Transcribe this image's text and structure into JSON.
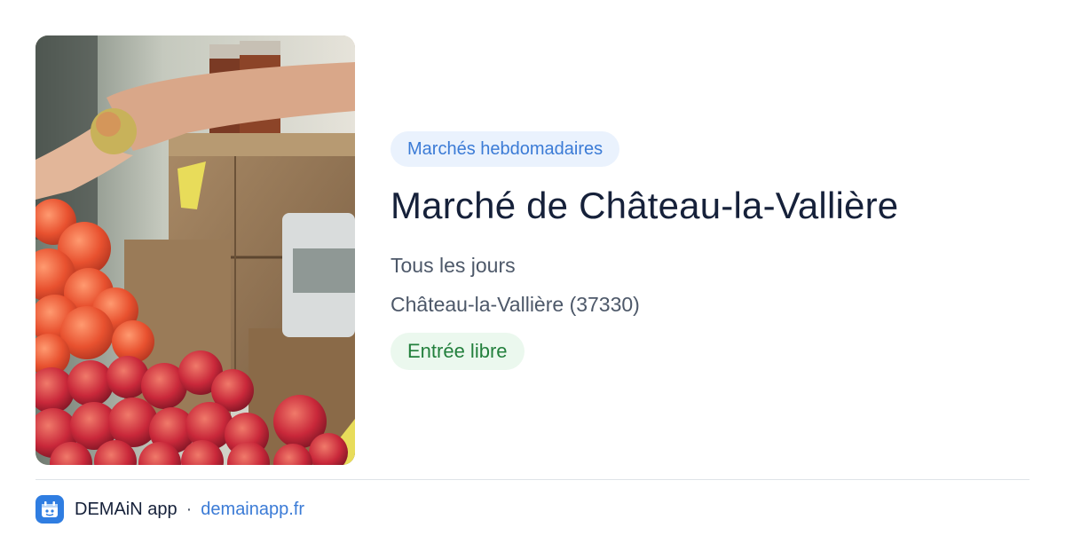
{
  "event": {
    "category": "Marchés hebdomadaires",
    "title": "Marché de Château-la-Vallière",
    "schedule": "Tous les jours",
    "location": "Château-la-Vallière (37330)",
    "access": "Entrée libre",
    "photo_icon": "market-stall-photo"
  },
  "footer": {
    "brand": "DEMAiN app",
    "separator": "·",
    "site": "demainapp.fr",
    "logo_icon": "demain-app-logo-icon"
  },
  "colors": {
    "accent": "#3b7bd6",
    "category_bg": "#eaf2fd",
    "access_text": "#23803d",
    "access_bg": "#ebf8ee",
    "title": "#16213a",
    "body_text": "#4d5869",
    "logo_bg": "#2f7de1"
  }
}
